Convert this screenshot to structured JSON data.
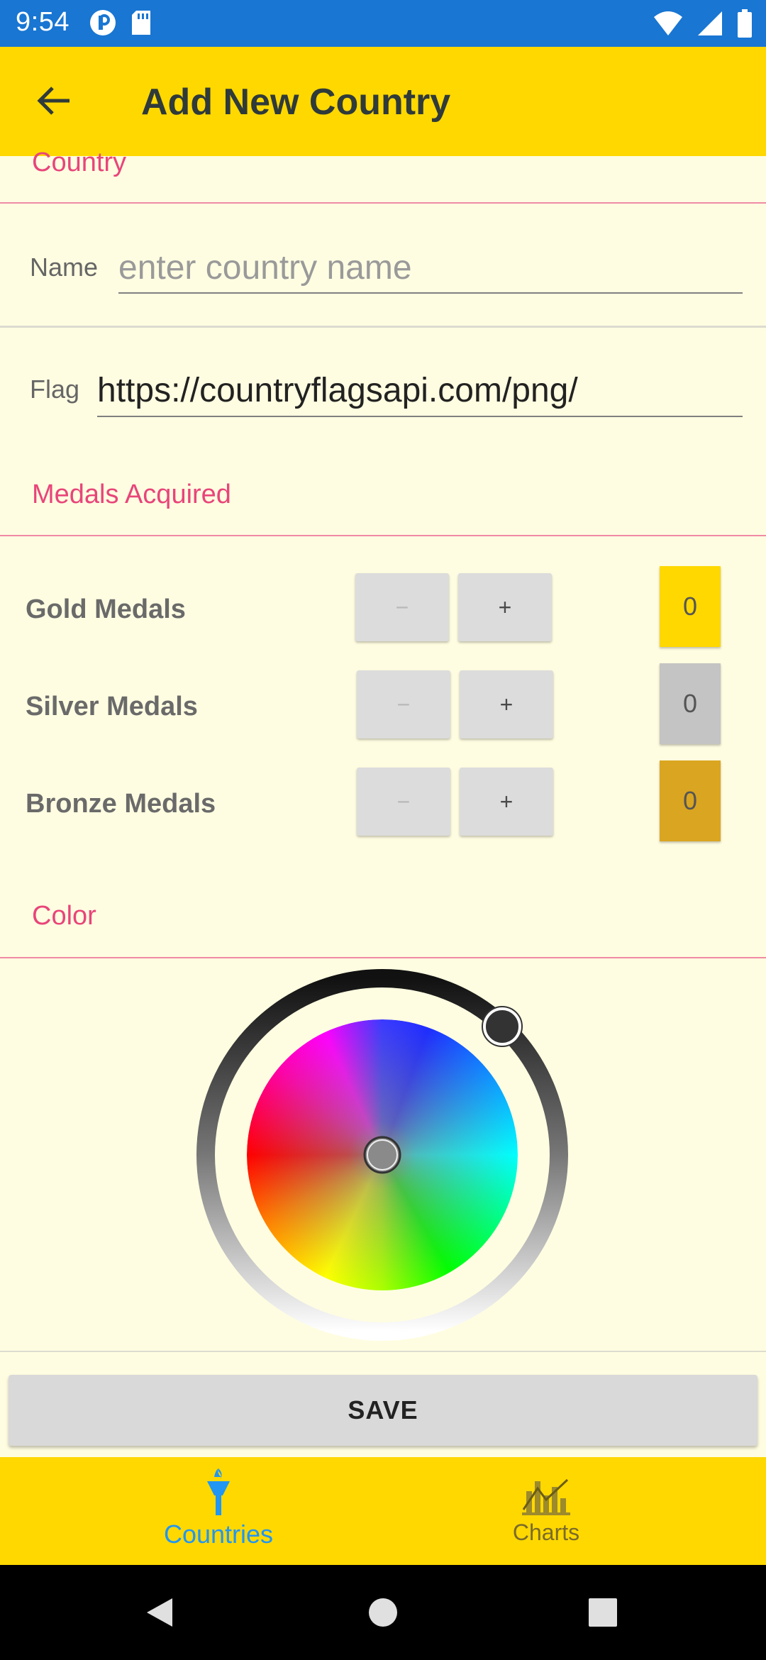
{
  "status_bar": {
    "time": "9:54"
  },
  "app_bar": {
    "title": "Add New Country"
  },
  "sections": {
    "country": "Country",
    "medals": "Medals Acquired",
    "color": "Color"
  },
  "form": {
    "name_label": "Name",
    "name_placeholder": "enter country name",
    "name_value": "",
    "flag_label": "Flag",
    "flag_value": "https://countryflagsapi.com/png/"
  },
  "medals": [
    {
      "label": "Gold Medals",
      "count": "0",
      "color": "#FFD800"
    },
    {
      "label": "Silver Medals",
      "count": "0",
      "color": "#C4C4C4"
    },
    {
      "label": "Bronze Medals",
      "count": "0",
      "color": "#DAA520"
    }
  ],
  "stepper": {
    "minus": "−",
    "plus": "+"
  },
  "save_label": "SAVE",
  "bottom_nav": [
    {
      "label": "Countries",
      "icon": "torch-icon",
      "active": true
    },
    {
      "label": "Charts",
      "icon": "chart-icon",
      "active": false
    }
  ],
  "colors": {
    "status_bar": "#1976D2",
    "app_bar": "#FFD800",
    "background": "#FFFDE1",
    "section_label": "#E8457A",
    "active_nav": "#2196F3"
  }
}
